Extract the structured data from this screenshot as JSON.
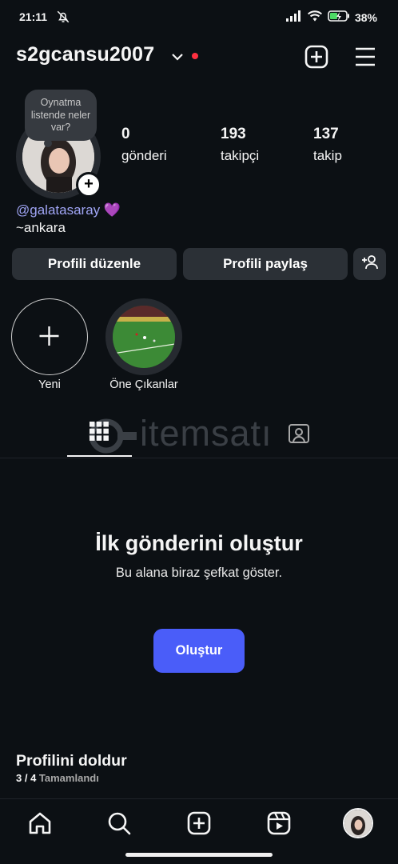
{
  "status": {
    "time": "21:11",
    "battery": "38%"
  },
  "header": {
    "username": "s2gcansu2007"
  },
  "profile": {
    "note": "Oynatma listende neler var?",
    "stats": [
      {
        "value": "0",
        "label": "gönderi"
      },
      {
        "value": "193",
        "label": "takipçi"
      },
      {
        "value": "137",
        "label": "takip"
      }
    ],
    "bio_link": "@galatasaray",
    "bio_emoji": "💜",
    "bio_text": "~ankara"
  },
  "buttons": {
    "edit": "Profili düzenle",
    "share": "Profili paylaş"
  },
  "highlights": [
    {
      "label": "Yeni"
    },
    {
      "label": "Öne Çıkanlar"
    }
  ],
  "watermark": "itemsatı",
  "empty": {
    "title": "İlk gönderini oluştur",
    "subtitle": "Bu alana biraz şefkat göster.",
    "button": "Oluştur"
  },
  "complete": {
    "title": "Profilini doldur",
    "progress": "3 / 4",
    "status": "Tamamlandı"
  },
  "icons": [
    "mute-icon",
    "signal-icon",
    "wifi-icon",
    "battery-icon",
    "chevron-down-icon",
    "new-post-icon",
    "menu-icon",
    "add-person-icon",
    "grid-icon",
    "tagged-icon",
    "home-icon",
    "search-icon",
    "create-icon",
    "reels-icon",
    "profile-avatar-icon"
  ],
  "colors": {
    "background": "#0c1014",
    "accent": "#4a5df9",
    "link": "#a0a5f5",
    "notification": "#ff3040"
  }
}
